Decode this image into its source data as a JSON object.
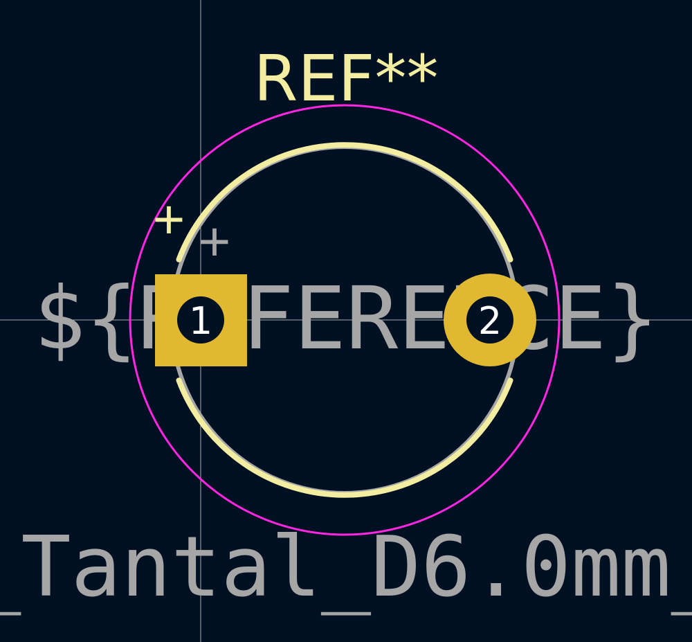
{
  "footprint": {
    "reference_label": "REF**",
    "reference_field": "${REFERENCE}",
    "value_label": "_Tantal_D6.0mm_",
    "polarity_mark_silk": "+",
    "polarity_mark_fab": "+"
  },
  "pads": [
    {
      "number": "1",
      "shape": "square"
    },
    {
      "number": "2",
      "shape": "circle"
    }
  ],
  "colors": {
    "background": "#001023",
    "silkscreen": "#f2eda1",
    "fab": "#a6a6a6",
    "courtyard": "#ff26e2",
    "pad_copper": "#e0b831",
    "pad_hole": "#001023",
    "pad_number": "#ffffff",
    "crosshair": "#c8c8c8"
  },
  "layers": [
    "F.SilkS",
    "F.Fab",
    "F.CrtYd",
    "F.Cu"
  ]
}
